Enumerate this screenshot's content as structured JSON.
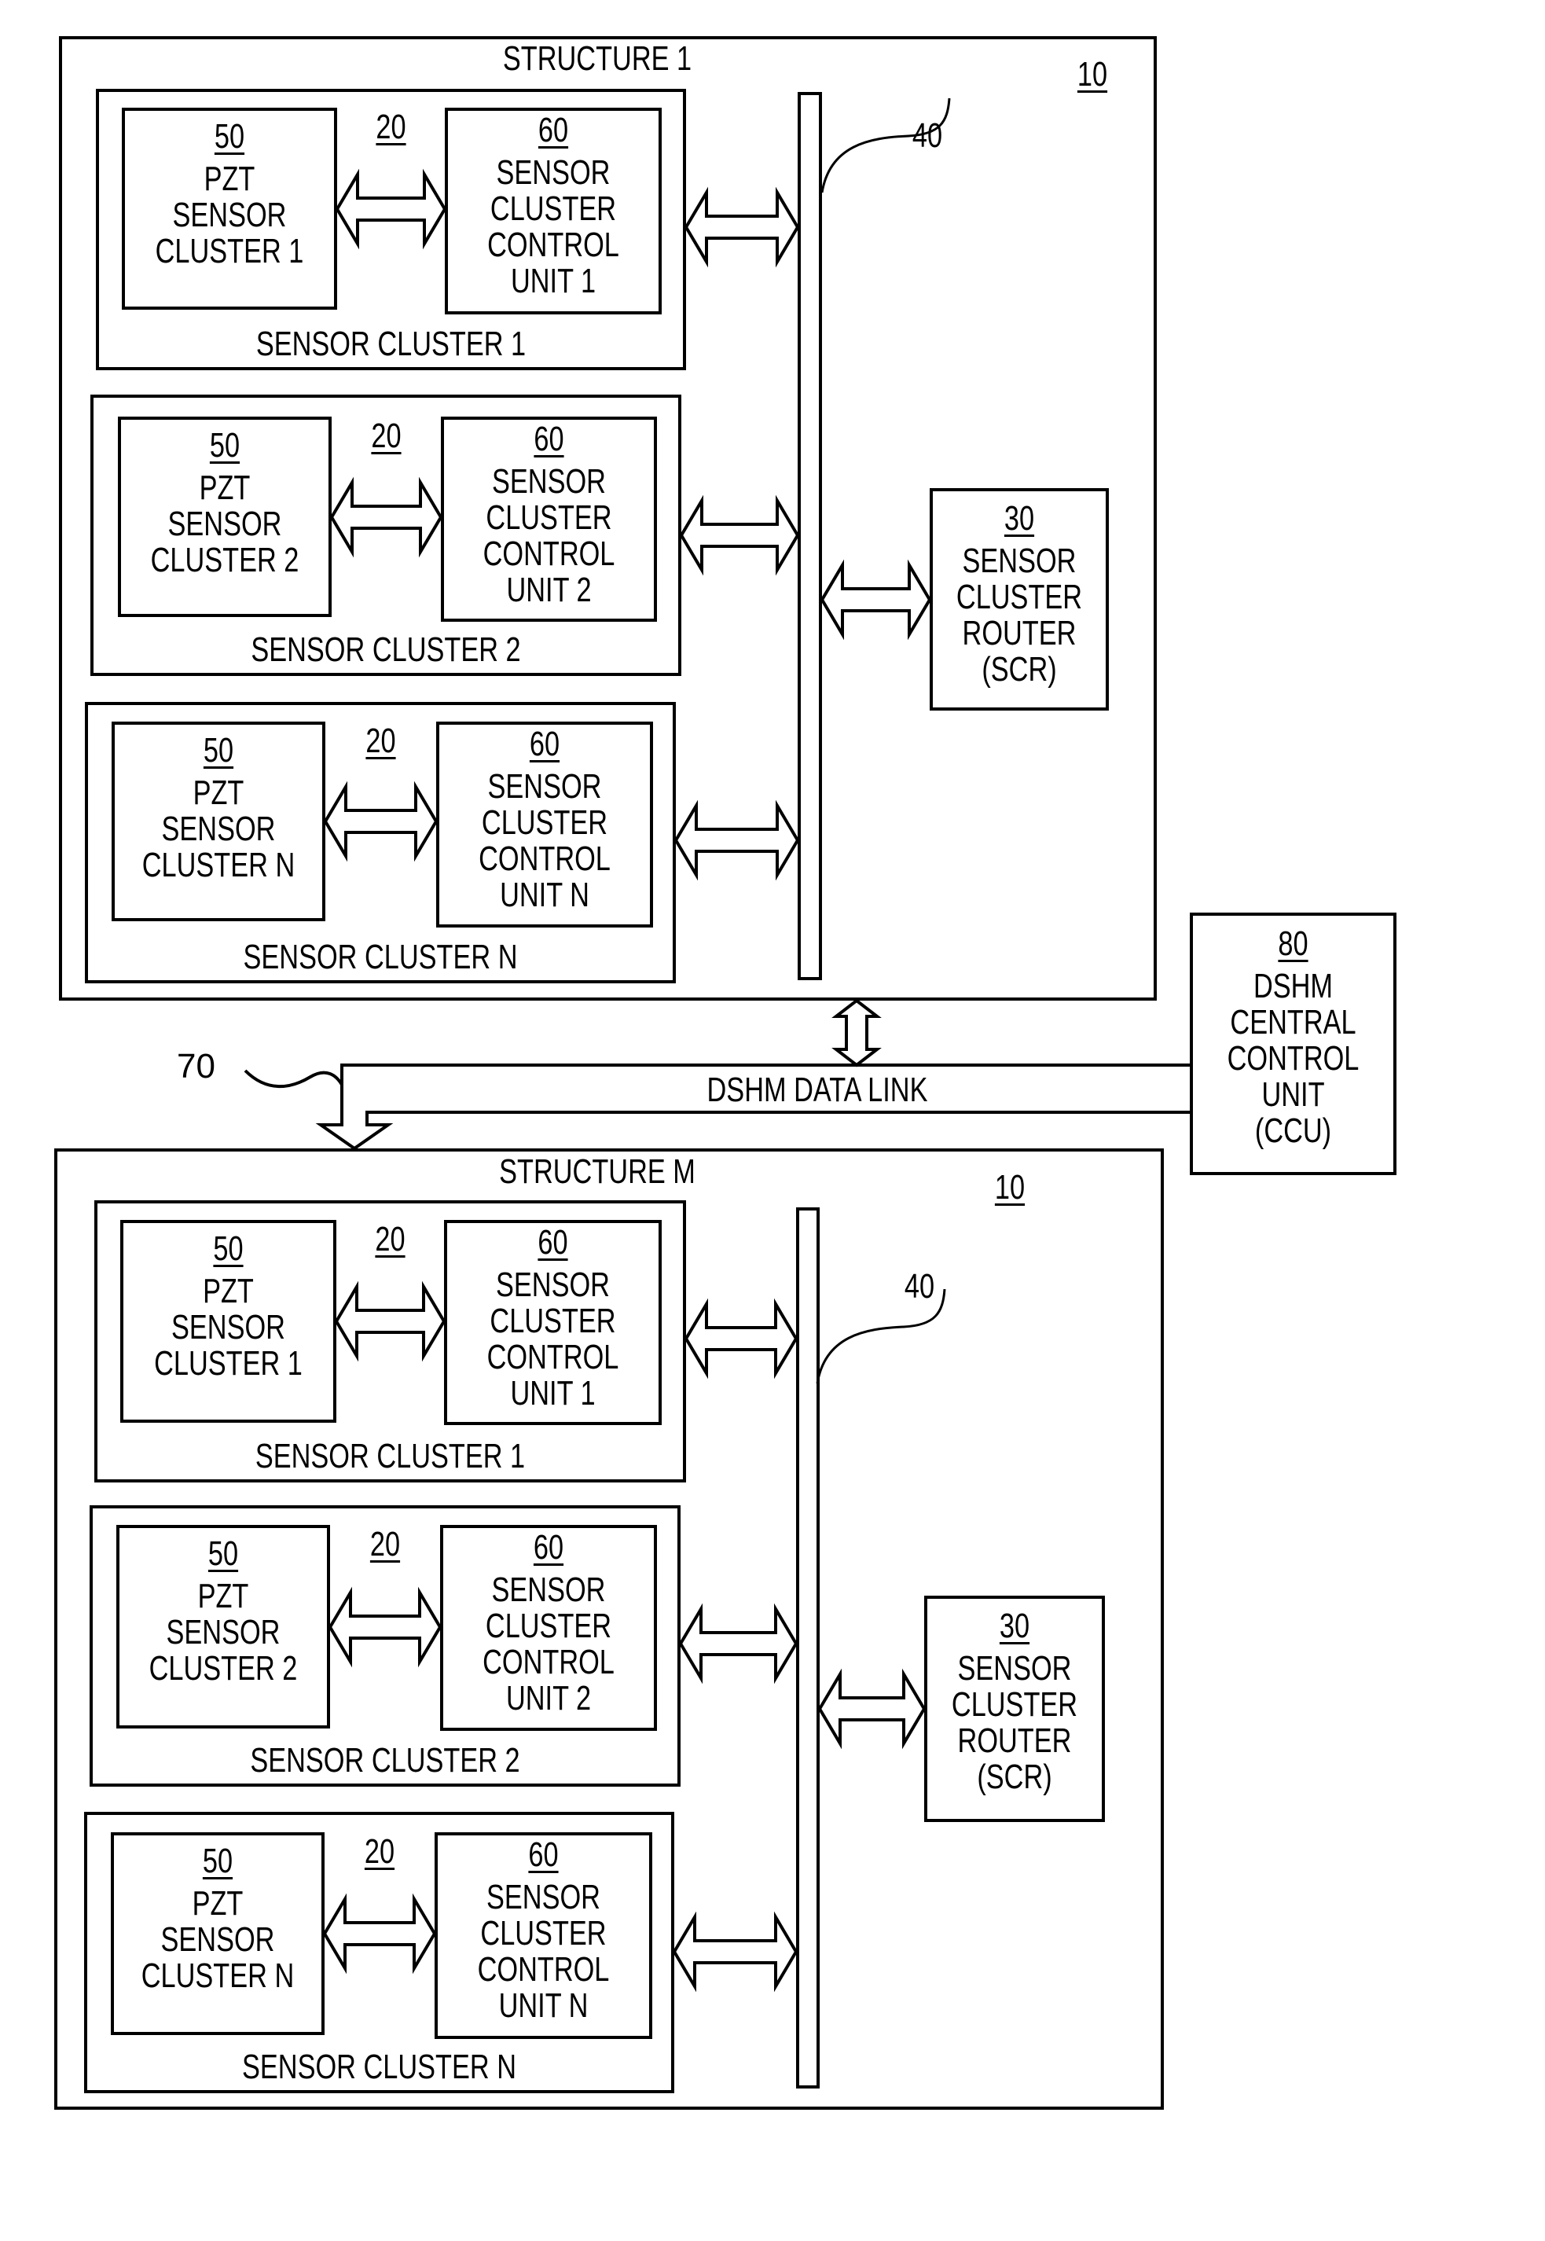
{
  "data_link": {
    "ref": "70",
    "label": "DSHM DATA LINK"
  },
  "ccu": {
    "ref": "80",
    "lines": [
      "DSHM",
      "CENTRAL",
      "CONTROL",
      "UNIT",
      "(CCU)"
    ]
  },
  "structures": [
    {
      "title": "STRUCTURE 1",
      "ref": "10",
      "bus_ref": "40",
      "router": {
        "ref": "30",
        "lines": [
          "SENSOR",
          "CLUSTER",
          "ROUTER",
          "(SCR)"
        ]
      },
      "clusters": [
        {
          "label": "SENSOR CLUSTER 1",
          "ref": "20",
          "pzt": {
            "ref": "50",
            "lines": [
              "PZT",
              "SENSOR",
              "CLUSTER 1"
            ]
          },
          "control": {
            "ref": "60",
            "lines": [
              "SENSOR",
              "CLUSTER",
              "CONTROL",
              "UNIT 1"
            ]
          }
        },
        {
          "label": "SENSOR CLUSTER 2",
          "ref": "20",
          "pzt": {
            "ref": "50",
            "lines": [
              "PZT",
              "SENSOR",
              "CLUSTER 2"
            ]
          },
          "control": {
            "ref": "60",
            "lines": [
              "SENSOR",
              "CLUSTER",
              "CONTROL",
              "UNIT 2"
            ]
          }
        },
        {
          "label": "SENSOR CLUSTER N",
          "ref": "20",
          "pzt": {
            "ref": "50",
            "lines": [
              "PZT",
              "SENSOR",
              "CLUSTER N"
            ]
          },
          "control": {
            "ref": "60",
            "lines": [
              "SENSOR",
              "CLUSTER",
              "CONTROL",
              "UNIT N"
            ]
          }
        }
      ]
    },
    {
      "title": "STRUCTURE M",
      "ref": "10",
      "bus_ref": "40",
      "router": {
        "ref": "30",
        "lines": [
          "SENSOR",
          "CLUSTER",
          "ROUTER",
          "(SCR)"
        ]
      },
      "clusters": [
        {
          "label": "SENSOR CLUSTER 1",
          "ref": "20",
          "pzt": {
            "ref": "50",
            "lines": [
              "PZT",
              "SENSOR",
              "CLUSTER 1"
            ]
          },
          "control": {
            "ref": "60",
            "lines": [
              "SENSOR",
              "CLUSTER",
              "CONTROL",
              "UNIT 1"
            ]
          }
        },
        {
          "label": "SENSOR CLUSTER 2",
          "ref": "20",
          "pzt": {
            "ref": "50",
            "lines": [
              "PZT",
              "SENSOR",
              "CLUSTER 2"
            ]
          },
          "control": {
            "ref": "60",
            "lines": [
              "SENSOR",
              "CLUSTER",
              "CONTROL",
              "UNIT 2"
            ]
          }
        },
        {
          "label": "SENSOR CLUSTER N",
          "ref": "20",
          "pzt": {
            "ref": "50",
            "lines": [
              "PZT",
              "SENSOR",
              "CLUSTER N"
            ]
          },
          "control": {
            "ref": "60",
            "lines": [
              "SENSOR",
              "CLUSTER",
              "CONTROL",
              "UNIT N"
            ]
          }
        }
      ]
    }
  ]
}
